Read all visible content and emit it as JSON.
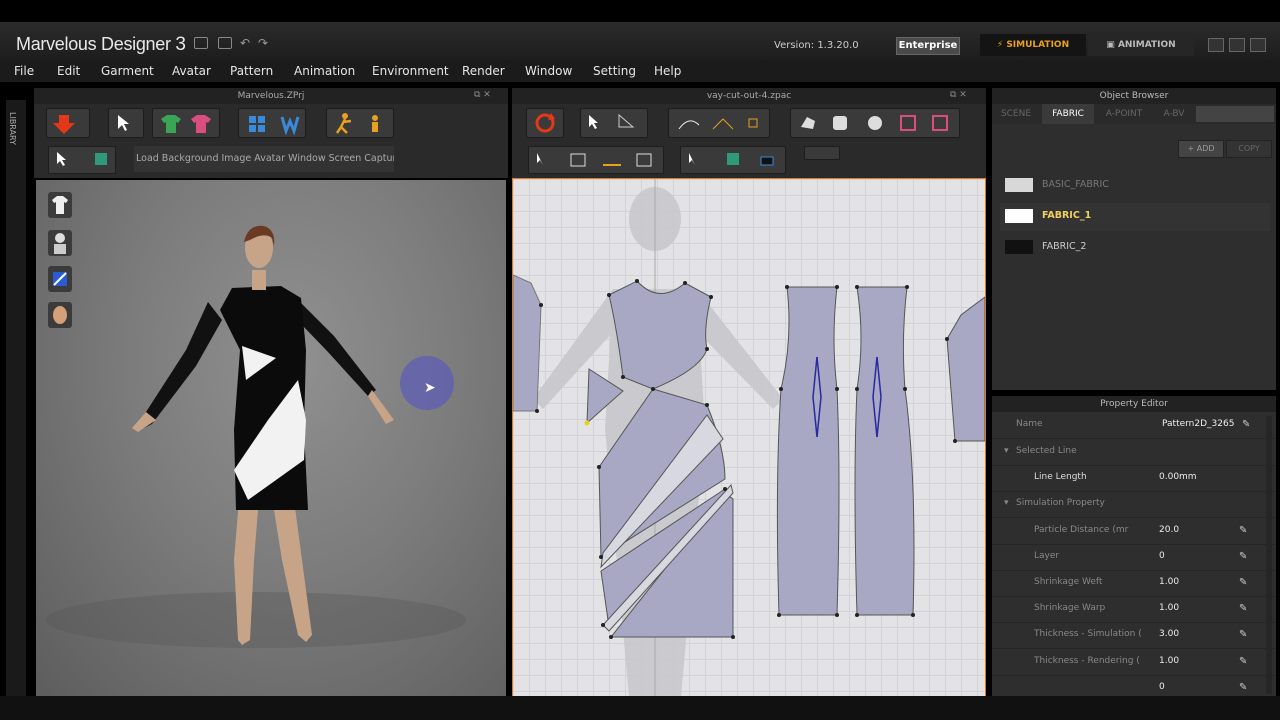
{
  "app": {
    "title_main": "Marvelous Designer",
    "title_version_num": "3",
    "version_text": "Version:  1.3.20.0",
    "edition_badge": "Enterprise",
    "mode_tabs": {
      "simulation": "SIMULATION",
      "animation": "ANIMATION"
    }
  },
  "menu": [
    "File",
    "Edit",
    "Garment",
    "Avatar",
    "Pattern",
    "Animation",
    "Environment",
    "Render",
    "Window",
    "Setting",
    "Help"
  ],
  "library_label": "LIBRARY",
  "view3d": {
    "file_name": "Marvelous.ZPrj",
    "load_strip_text": "Load Background Image Avatar Window Screen Capture"
  },
  "view2d": {
    "file_name": "vay-cut-out-4.zpac"
  },
  "object_browser": {
    "title": "Object Browser",
    "tabs": [
      "SCENE",
      "FABRIC",
      "A-POINT",
      "A-BV"
    ],
    "active_tab": "FABRIC",
    "add_label": "ADD",
    "copy_label": "COPY",
    "fabrics": [
      {
        "name": "BASIC_FABRIC",
        "color": "#d8d8d8",
        "selected": false
      },
      {
        "name": "FABRIC_1",
        "color": "#ffffff",
        "selected": true
      },
      {
        "name": "FABRIC_2",
        "color": "#111111",
        "selected": false
      }
    ]
  },
  "property_editor": {
    "title": "Property Editor",
    "name_label": "Name",
    "name_value": "Pattern2D_3265",
    "selected_line_section": "Selected Line",
    "line_length_label": "Line Length",
    "line_length_value": "0.00mm",
    "simulation_section": "Simulation Property",
    "rows": [
      {
        "label": "Particle Distance (mr",
        "value": "20.0"
      },
      {
        "label": "Layer",
        "value": "0"
      },
      {
        "label": "Shrinkage Weft",
        "value": "1.00"
      },
      {
        "label": "Shrinkage Warp",
        "value": "1.00"
      },
      {
        "label": "Thickness - Simulation (",
        "value": "3.00"
      },
      {
        "label": "Thickness - Rendering (",
        "value": "1.00"
      },
      {
        "label": "",
        "value": "0"
      }
    ]
  },
  "colors": {
    "accent_orange": "#e07a20",
    "sim_text": "#e8a020",
    "pattern_fill": "#a8a8c4"
  }
}
